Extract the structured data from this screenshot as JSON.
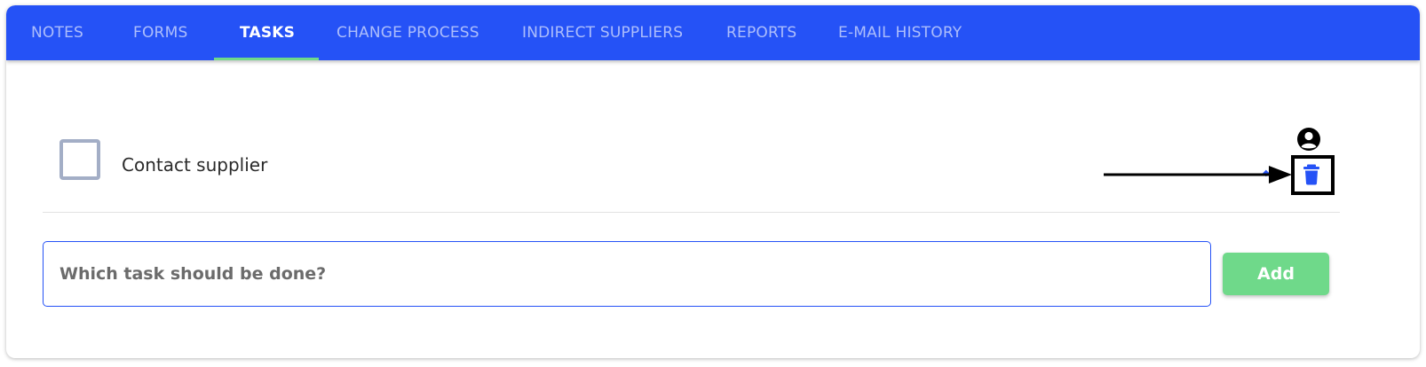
{
  "tabs": [
    {
      "label": "NOTES",
      "active": false
    },
    {
      "label": "FORMS",
      "active": false
    },
    {
      "label": "TASKS",
      "active": true
    },
    {
      "label": "CHANGE PROCESS",
      "active": false
    },
    {
      "label": "INDIRECT SUPPLIERS",
      "active": false
    },
    {
      "label": "REPORTS",
      "active": false
    },
    {
      "label": "E-MAIL HISTORY",
      "active": false
    }
  ],
  "tasks": [
    {
      "label": "Contact supplier",
      "checked": false
    }
  ],
  "new_task": {
    "placeholder": "Which task should be done?",
    "value": ""
  },
  "add_button_label": "Add",
  "icons": {
    "user": "user-circle-icon",
    "delete": "trash-icon"
  },
  "colors": {
    "primary": "#2552f6",
    "accent": "#6fd98a",
    "checkbox_border": "#a3aec6"
  }
}
